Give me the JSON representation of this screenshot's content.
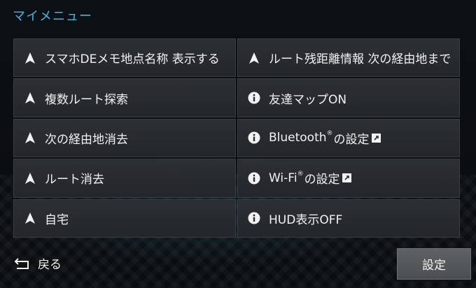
{
  "header": {
    "title": "マイメニュー"
  },
  "menu": {
    "left": [
      {
        "icon": "navigation-arrow-icon",
        "label": "スマホDEメモ地点名称 表示する"
      },
      {
        "icon": "navigation-arrow-icon",
        "label": "複数ルート探索"
      },
      {
        "icon": "navigation-arrow-icon",
        "label": "次の経由地消去"
      },
      {
        "icon": "navigation-arrow-icon",
        "label": "ルート消去"
      },
      {
        "icon": "navigation-arrow-icon",
        "label": "自宅"
      }
    ],
    "right": [
      {
        "icon": "navigation-arrow-icon",
        "label": "ルート残距離情報 次の経由地まで"
      },
      {
        "icon": "info-icon",
        "label": "友達マップON"
      },
      {
        "icon": "info-icon",
        "label_main": "Bluetooth",
        "label_mark": "®",
        "label_suffix": "の設定",
        "ext_icon": "external-link-icon"
      },
      {
        "icon": "info-icon",
        "label_main": "Wi-Fi",
        "label_mark": "®",
        "label_suffix": "の設定",
        "ext_icon": "external-link-icon"
      },
      {
        "icon": "info-icon",
        "label": "HUD表示OFF"
      }
    ]
  },
  "footer": {
    "back_icon": "return-arrow-icon",
    "back_label": "戻る",
    "settings_label": "設定"
  },
  "colors": {
    "title": "#3fb7e4",
    "cell_bg": "#2c2f33",
    "text": "#f2f2f2",
    "button_bg": "#5f6265"
  }
}
